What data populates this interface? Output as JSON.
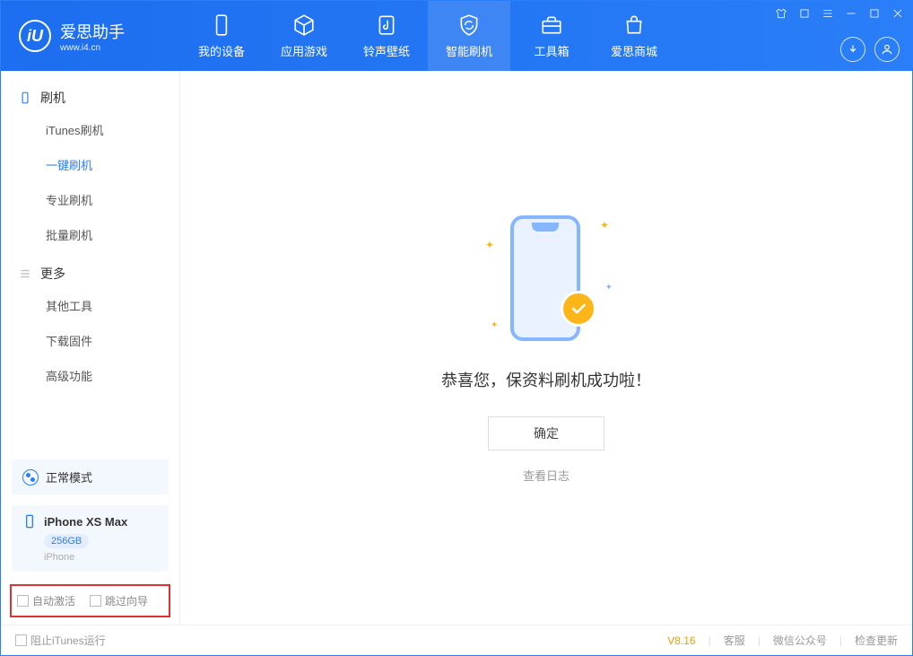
{
  "app": {
    "title": "爱思助手",
    "subtitle": "www.i4.cn"
  },
  "nav": {
    "tabs": [
      {
        "label": "我的设备"
      },
      {
        "label": "应用游戏"
      },
      {
        "label": "铃声壁纸"
      },
      {
        "label": "智能刷机"
      },
      {
        "label": "工具箱"
      },
      {
        "label": "爱思商城"
      }
    ]
  },
  "sidebar": {
    "section1": {
      "title": "刷机",
      "items": [
        "iTunes刷机",
        "一键刷机",
        "专业刷机",
        "批量刷机"
      ]
    },
    "section2": {
      "title": "更多",
      "items": [
        "其他工具",
        "下载固件",
        "高级功能"
      ]
    },
    "mode_label": "正常模式",
    "device": {
      "name": "iPhone XS Max",
      "storage": "256GB",
      "type": "iPhone"
    },
    "auto_activate": "自动激活",
    "skip_wizard": "跳过向导"
  },
  "main": {
    "success_text": "恭喜您，保资料刷机成功啦！",
    "ok_button": "确定",
    "view_log": "查看日志"
  },
  "footer": {
    "block_itunes": "阻止iTunes运行",
    "version": "V8.16",
    "links": [
      "客服",
      "微信公众号",
      "检查更新"
    ]
  }
}
